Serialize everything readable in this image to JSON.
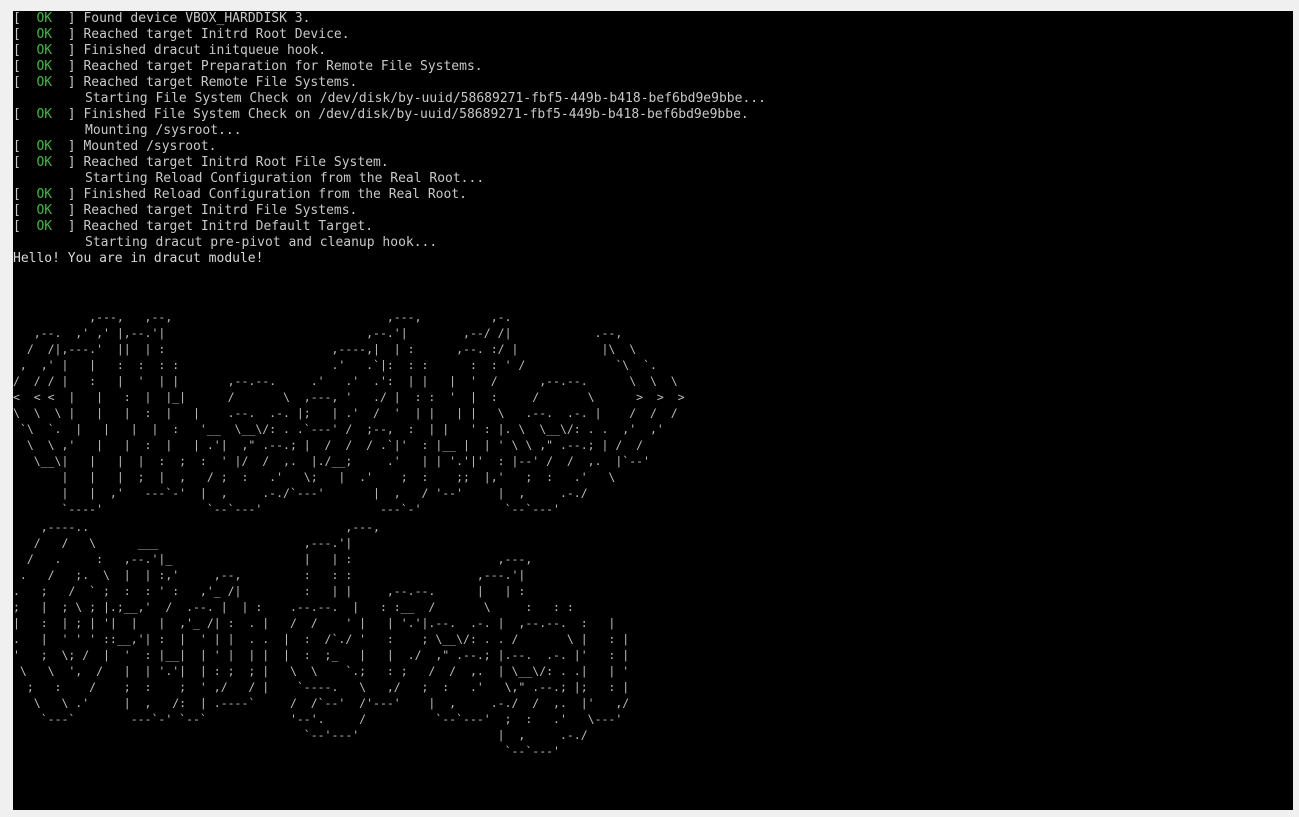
{
  "theme": {
    "background": "#000000",
    "frame": "#f0f0f0",
    "text": "#c8c8c8",
    "ok_color": "#3dbd3d"
  },
  "console": {
    "ok_label": "OK",
    "lines": [
      {
        "ok": true,
        "text": "Found device VBOX_HARDDISK 3."
      },
      {
        "ok": true,
        "text": "Reached target Initrd Root Device."
      },
      {
        "ok": true,
        "text": "Finished dracut initqueue hook."
      },
      {
        "ok": true,
        "text": "Reached target Preparation for Remote File Systems."
      },
      {
        "ok": true,
        "text": "Reached target Remote File Systems."
      },
      {
        "ok": false,
        "text": "Starting File System Check on /dev/disk/by-uuid/58689271-fbf5-449b-b418-bef6bd9e9bbe..."
      },
      {
        "ok": true,
        "text": "Finished File System Check on /dev/disk/by-uuid/58689271-fbf5-449b-b418-bef6bd9e9bbe."
      },
      {
        "ok": false,
        "text": "Mounting /sysroot..."
      },
      {
        "ok": true,
        "text": "Mounted /sysroot."
      },
      {
        "ok": true,
        "text": "Reached target Initrd Root File System."
      },
      {
        "ok": false,
        "text": "Starting Reload Configuration from the Real Root..."
      },
      {
        "ok": true,
        "text": "Finished Reload Configuration from the Real Root."
      },
      {
        "ok": true,
        "text": "Reached target Initrd File Systems."
      },
      {
        "ok": true,
        "text": "Reached target Initrd Default Target."
      },
      {
        "ok": false,
        "text": "Starting dracut pre-pivot and cleanup hook..."
      }
    ],
    "hello": "Hello! You are in dracut module!"
  },
  "ascii_art": {
    "banner_top": "           ,---,   ,--,                               ,---,          ,-.\n   ,--.  ,' ,' |,--.'|                             ,--.'|        ,--/ /|            .--,\n  /  /|,---.'  ||  | :                        ,----,|  | :      ,--. :/ |            |\\  \\\n ,  ,' |   |   :  :  : :                      .'   .`|:  : :      :  : ' /             `\\  `.\n/  / / |   :   |  '  | |       ,--.--.     .'   .'  .':  | |   |  '  /      ,--.--.      \\  \\  \\\n<  < <  |   |   :  |  |_|      /       \\  ,---, '   ./ |  : :  '  |  :     /       \\      >  >  >\n\\  \\  \\ |   |   |  :  |   |    .--.  .-. |;   | .'  /  '  | |   | |   \\   .--.  .-. |    /  /  /\n `\\  `.  |   |   |  |  :   '__  \\__\\/: . .`---' /  ;--,  :  | |   ' : |. \\  \\__\\/: . .  ,'  ,'\n  \\  \\ ,'   |   |  :  |   | .'|  ,\" .--.; |  /  /  / .`|'  : |__ |  | ' \\ \\ ,\" .--.; | /  /\n   \\__\\|   |   |  |  :  ;  :  ' |/  /  ,.  |./__;     .'   | | '.'|'  : |--' /  /  ,.  |`--'\n       |   |   |  ;  |  ,   / ;  :   .'   \\;   |  .'    ;  :    ;;  |,'   ;  :   .'   \\\n       |   |  ,'   ---`-'  |  ,     .-./`---'       |  ,   / '--'     |  ,     .-./\n       `----'               `--`---'                 ---`-'            `--`---'",
    "banner_bottom": "    ,----..                                     ,---,\n   /   /   \\      ___                     ,---.'|\n  /   .     :   ,--.'|_                   |   | :                     ,---,\n .   /   ;.  \\  |  | :,'     ,--,         :   : :                  ,---.'|\n.   ;   /  ` ;  :  : ' :   ,'_ /|         :   | |     ,--.--.      |   | :\n;   |  ; \\ ; |.;__,'  /  .--. |  | :    .--.--.  |   : :__  /       \\     :   : :\n|   :  | ; | '|  |   |  ,'_ /| :  . |   /  /    ' |   | '.'|.--.  .-. |  ,--.--.  :   |\n.   |  ' ' ' ::__,'| :  |  ' | |  . .  |  :  /`./ '   :    ; \\__\\/: . . /       \\ |   : |\n'   ;  \\; /  |  '  : |__|  | ' |  | |  |  :  ;_   |   |  ./  ,\" .--.; |.--.  .-. |'   : |\n \\   \\  ',  /   |  | '.'|  | : ;  ; |   \\  \\    `.;   : ;   /  /  ,.  | \\__\\/: . .|   | '\n  ;   :    /    ;  :    ;  ' ,/   / |    `----.   \\   ,/   ;  :   .'   \\,\" .--.; |;   : |\n   \\   \\ .'     |  ,   /:  | .----`     /  /`--'  /'---'    |  ,     .-./  /  ,.  |'   ,/\n    `---`        ---`-' `--`            '--'.     /          `--`---'  ;  :   .'   \\---'\n                                          `--'---'                    |  ,     .-./\n                                                                       `--`---'"
  }
}
